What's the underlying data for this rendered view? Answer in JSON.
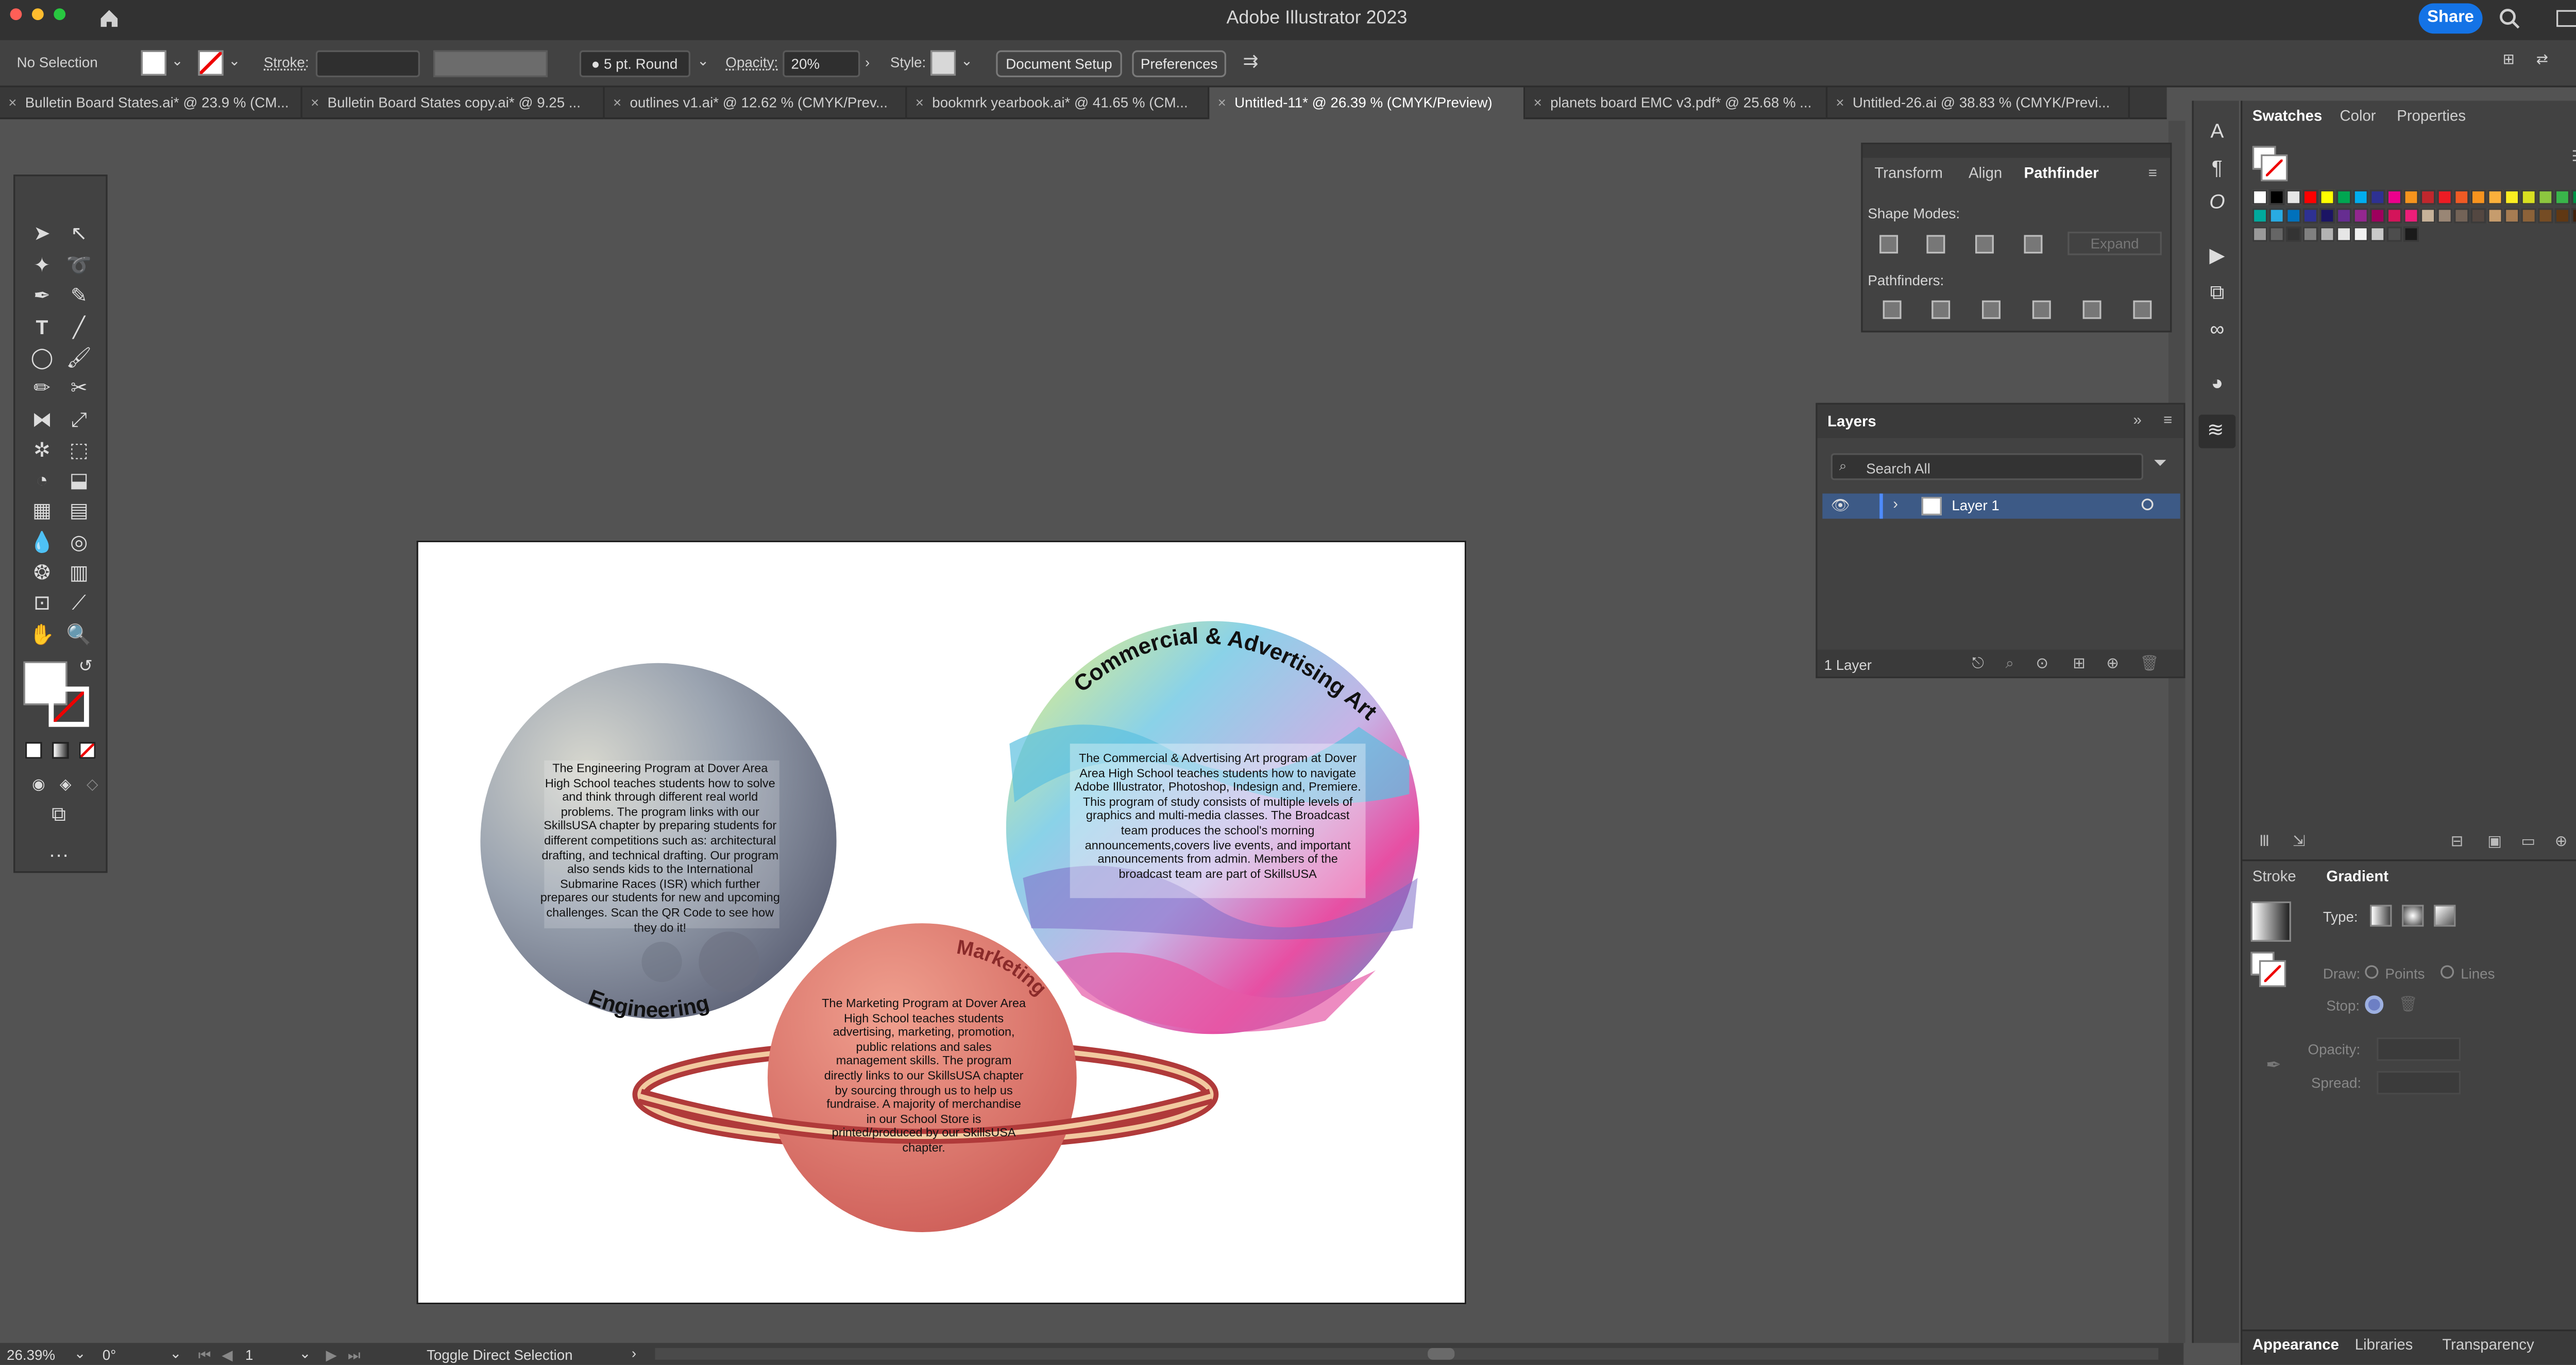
{
  "app": {
    "title": "Adobe Illustrator 2023",
    "share_label": "Share"
  },
  "control_bar": {
    "selection": "No Selection",
    "stroke_label": "Stroke:",
    "brush": "5 pt. Round",
    "opacity_label": "Opacity:",
    "opacity_value": "20%",
    "style_label": "Style:",
    "document_setup": "Document Setup",
    "preferences": "Preferences"
  },
  "doc_tabs": [
    {
      "label": "Bulletin Board States.ai* @ 23.9 % (CM...",
      "active": false
    },
    {
      "label": "Bulletin Board States copy.ai* @ 9.25 ...",
      "active": false
    },
    {
      "label": "outlines v1.ai* @ 12.62 % (CMYK/Prev...",
      "active": false
    },
    {
      "label": "bookmrk yearbook.ai* @ 41.65 % (CM...",
      "active": false
    },
    {
      "label": "Untitled-11* @ 26.39 % (CMYK/Preview)",
      "active": true
    },
    {
      "label": "planets board EMC v3.pdf* @ 25.68 % ...",
      "active": false
    },
    {
      "label": "Untitled-26.ai @ 38.83 % (CMYK/Previ...",
      "active": false
    }
  ],
  "pathfinder_panel": {
    "tabs": [
      "Transform",
      "Align",
      "Pathfinder"
    ],
    "active_tab": "Pathfinder",
    "shape_modes_label": "Shape Modes:",
    "expand_label": "Expand",
    "pathfinders_label": "Pathfinders:"
  },
  "layers_panel": {
    "title": "Layers",
    "search_placeholder": "Search All",
    "layer_name": "Layer 1",
    "count": "1 Layer"
  },
  "right_panel": {
    "top_tabs": [
      "Swatches",
      "Color",
      "Properties"
    ],
    "gradient_tabs": [
      "Stroke",
      "Gradient"
    ],
    "gradient": {
      "type_label": "Type:",
      "draw_label": "Draw:",
      "points_label": "Points",
      "lines_label": "Lines",
      "stop_label": "Stop:",
      "opacity_label": "Opacity:",
      "spread_label": "Spread:"
    },
    "bottom_tabs": [
      "Appearance",
      "Libraries",
      "Transparency"
    ]
  },
  "status_bar": {
    "zoom": "26.39%",
    "rotation": "0°",
    "artboard": "1",
    "tool_hint": "Toggle Direct Selection"
  },
  "artwork": {
    "engineering": {
      "title": "Engineering",
      "body": "The Engineering Program at Dover Area High School teaches students how to solve and think through different real world problems. The program links with our SkillsUSA chapter by preparing students for different competitions such as: architectural drafting, and technical drafting. Our program also sends kids to the International Submarine Races (ISR) which further prepares our students for new and upcoming challenges. Scan the QR Code to see how they do it!"
    },
    "commercial": {
      "title": "Commercial & Advertising Art",
      "body": "The Commercial & Advertising Art program at Dover Area High School teaches students how to navigate Adobe Illustrator, Photoshop, Indesign and, Premiere. This program of study consists of multiple levels of graphics and multi-media classes. The Broadcast team produces the school's morning announcements,covers live events, and important announcements from admin. Members of the broadcast team are part of SkillsUSA"
    },
    "marketing": {
      "title": "Marketing",
      "body": "The Marketing Program at Dover Area High School teaches students advertising, marketing, promotion, public relations and sales management skills. The program directly links to our SkillsUSA chapter by sourcing through us to help us fundraise. A majority of merchandise in our School Store is printed/produced by our SkillsUSA chapter."
    }
  },
  "colors": {
    "accent": "#1473e6",
    "app_bg": "#535353",
    "panel_bg": "#424242",
    "titlebar_bg": "#323232",
    "layer_highlight": "#3d5a86"
  },
  "swatch_colors": [
    "#ffffff",
    "#000000",
    "#e6e6e6",
    "#ff0000",
    "#ffff00",
    "#00a651",
    "#00aeef",
    "#2e3192",
    "#ec008c",
    "#f7941d",
    "#c1272d",
    "#ed1c24",
    "#f15a24",
    "#f7931e",
    "#fbb03b",
    "#fcee21",
    "#d9e021",
    "#8cc63f",
    "#39b54a",
    "#009245",
    "#006837",
    "#22b573",
    "#00a99d",
    "#29abe2",
    "#0071bc",
    "#2e3192",
    "#1b1464",
    "#662d91",
    "#93278f",
    "#9e005d",
    "#d4145a",
    "#ed1e79",
    "#c7b299",
    "#998675",
    "#736357",
    "#534741",
    "#c69c6d",
    "#a67c52",
    "#8c6239",
    "#754c24",
    "#603813",
    "#42210b",
    "#ffffff",
    "#cccccc",
    "#999999",
    "#666666",
    "#333333",
    "#808080",
    "#b3b3b3",
    "#e6e6e6",
    "#f2f2f2",
    "#c9c9c9",
    "#4d4d4d",
    "#1a1a1a"
  ]
}
